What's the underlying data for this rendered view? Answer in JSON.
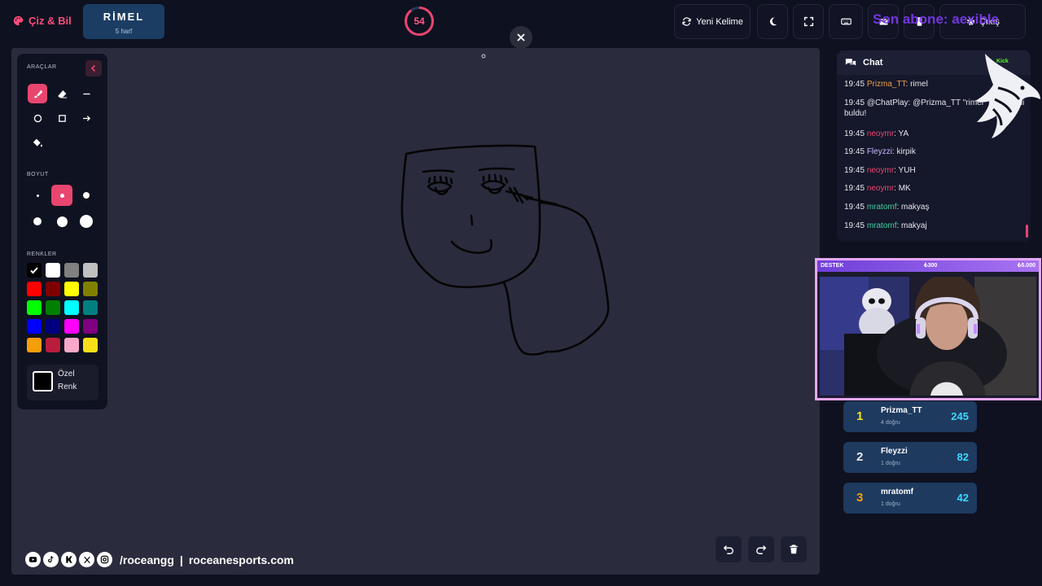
{
  "header": {
    "brand": "Çiz & Bil",
    "word": "RİMEL",
    "word_hint": "5 harf",
    "timer": "54",
    "new_word_label": "Yeni Kelime",
    "exit_label": "Çıkış",
    "overlay_text": "Son abone: aexible"
  },
  "tools": {
    "tools_label": "ARAÇLAR",
    "size_label": "BOYUT",
    "colors_label": "RENKLER",
    "custom_color_label": "Özel Renk",
    "colors": [
      "#000000",
      "#ffffff",
      "#808080",
      "#c0c0c0",
      "#ff0000",
      "#800000",
      "#ffff00",
      "#808000",
      "#00ff00",
      "#008000",
      "#00ffff",
      "#008080",
      "#0000ff",
      "#000080",
      "#ff00ff",
      "#800080",
      "#f59e0b",
      "#b91c3c",
      "#f9a8c9",
      "#f7e01a"
    ],
    "selected_color": "#000000"
  },
  "footer": {
    "handle": "/roceangg",
    "separator": "|",
    "site": "roceanesports.com"
  },
  "chat": {
    "title": "Chat",
    "platform": "Kick",
    "messages": [
      {
        "time": "19:45",
        "user": "Prizma_TT",
        "text": ": rimel",
        "color": "#f0a24a"
      },
      {
        "time": "19:45",
        "user": "",
        "text": "@ChatPlay: @Prizma_TT \"rimel\" kelimesini buldu!",
        "color": "#e6e6ee"
      },
      {
        "time": "19:45",
        "user": "neoymr",
        "text": ": YA",
        "color": "#e8456f"
      },
      {
        "time": "19:45",
        "user": "Fleyzzi",
        "text": ": kirpik",
        "color": "#c9b8ff"
      },
      {
        "time": "19:45",
        "user": "neoymr",
        "text": ": YUH",
        "color": "#e8456f"
      },
      {
        "time": "19:45",
        "user": "neoymr",
        "text": ": MK",
        "color": "#e8456f"
      },
      {
        "time": "19:45",
        "user": "mratomf",
        "text": ": makyaş",
        "color": "#3fd1a0"
      },
      {
        "time": "19:45",
        "user": "mratomf",
        "text": ": makyaj",
        "color": "#3fd1a0"
      }
    ]
  },
  "support": {
    "label": "DESTEK",
    "amount_1": "₺300",
    "amount_2": "₺5.000"
  },
  "leaderboard": [
    {
      "rank": "1",
      "name": "Prizma_TT",
      "sub": "4 doğru",
      "score": "245",
      "rank_color": "#f7e01a"
    },
    {
      "rank": "2",
      "name": "Fleyzzi",
      "sub": "1 doğru",
      "score": "82",
      "rank_color": "#e5e7eb"
    },
    {
      "rank": "3",
      "name": "mratomf",
      "sub": "1 doğru",
      "score": "42",
      "rank_color": "#f59e0b"
    }
  ]
}
